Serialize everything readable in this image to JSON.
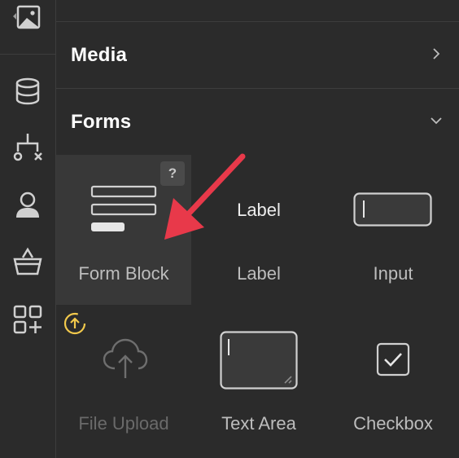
{
  "colors": {
    "accent_arrow": "#e8394a",
    "upgrade_badge": "#f2c94c",
    "panel_bg": "#2b2b2b"
  },
  "rail": {
    "items": [
      {
        "icon": "image-icon"
      },
      {
        "icon": "database-icon"
      },
      {
        "icon": "logic-flow-icon"
      },
      {
        "icon": "user-icon"
      },
      {
        "icon": "basket-icon"
      },
      {
        "icon": "apps-add-icon"
      }
    ]
  },
  "sections": {
    "media": {
      "title": "Media",
      "state": "collapsed"
    },
    "forms": {
      "title": "Forms",
      "state": "expanded"
    }
  },
  "forms": {
    "form_block": {
      "label": "Form Block",
      "help": "?"
    },
    "label": {
      "label": "Label",
      "preview_text": "Label"
    },
    "input": {
      "label": "Input"
    },
    "file_upload": {
      "label": "File Upload"
    },
    "text_area": {
      "label": "Text Area"
    },
    "checkbox": {
      "label": "Checkbox"
    }
  }
}
